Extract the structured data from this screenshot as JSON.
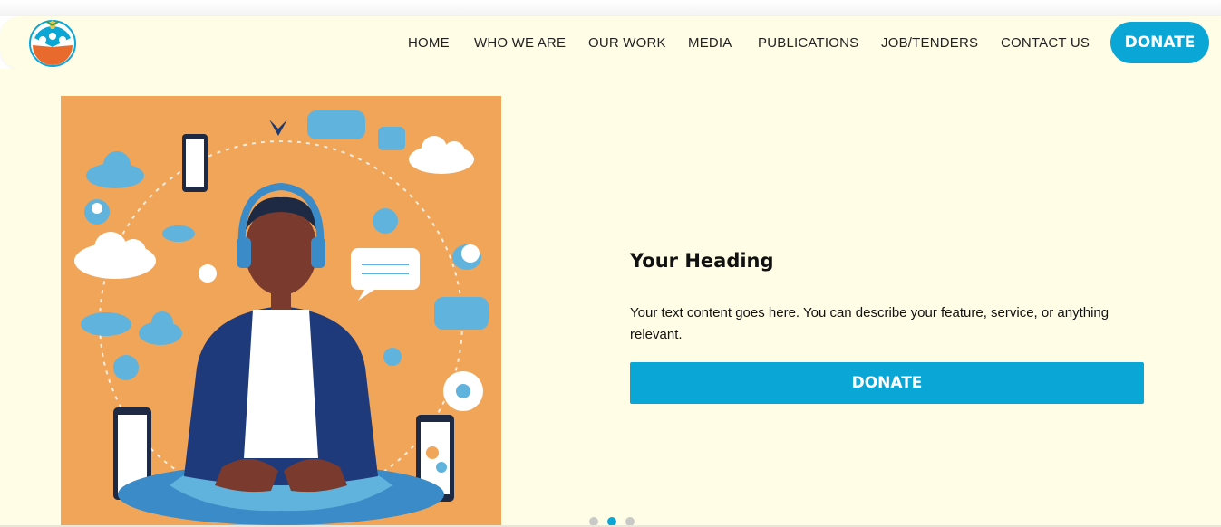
{
  "brand": {
    "logo_icon": "people-circle-logo-icon",
    "accent": "#0aa6d6",
    "background": "#fffde6"
  },
  "nav": {
    "items": [
      "HOME",
      "WHO WE ARE",
      "OUR WORK",
      "MEDIA",
      "PUBLICATIONS",
      "JOB/TENDERS",
      "CONTACT US"
    ],
    "donate_label": "DONATE"
  },
  "hero": {
    "image_icon": "meditating-person-with-headphones-illustration",
    "heading": "Your Heading",
    "text": "Your text content goes here. You can describe your feature, service, or anything relevant.",
    "donate_label": "DONATE"
  },
  "carousel": {
    "slide_count": 3,
    "active_index": 1
  }
}
